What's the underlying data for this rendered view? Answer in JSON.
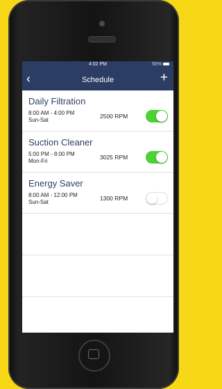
{
  "status_bar": {
    "time": "4:02 PM",
    "battery": "56%"
  },
  "nav": {
    "title": "Schedule",
    "back_icon": "chevron-left-icon",
    "add_icon": "plus-icon"
  },
  "schedules": [
    {
      "name": "Daily Filtration",
      "time": "8:00 AM - 4:00 PM",
      "days": "Sun-Sat",
      "rpm": "2500 RPM",
      "enabled": true
    },
    {
      "name": "Suction Cleaner",
      "time": "5:00 PM - 8:00 PM",
      "days": "Mon-Fri",
      "rpm": "3025 RPM",
      "enabled": true
    },
    {
      "name": "Energy Saver",
      "time": "8:00 AM - 12:00 PM",
      "days": "Sun-Sat",
      "rpm": "1300 RPM",
      "enabled": false
    }
  ],
  "colors": {
    "navbar": "#2c3d63",
    "toggle_on": "#4cd137",
    "background": "#f7d816"
  }
}
